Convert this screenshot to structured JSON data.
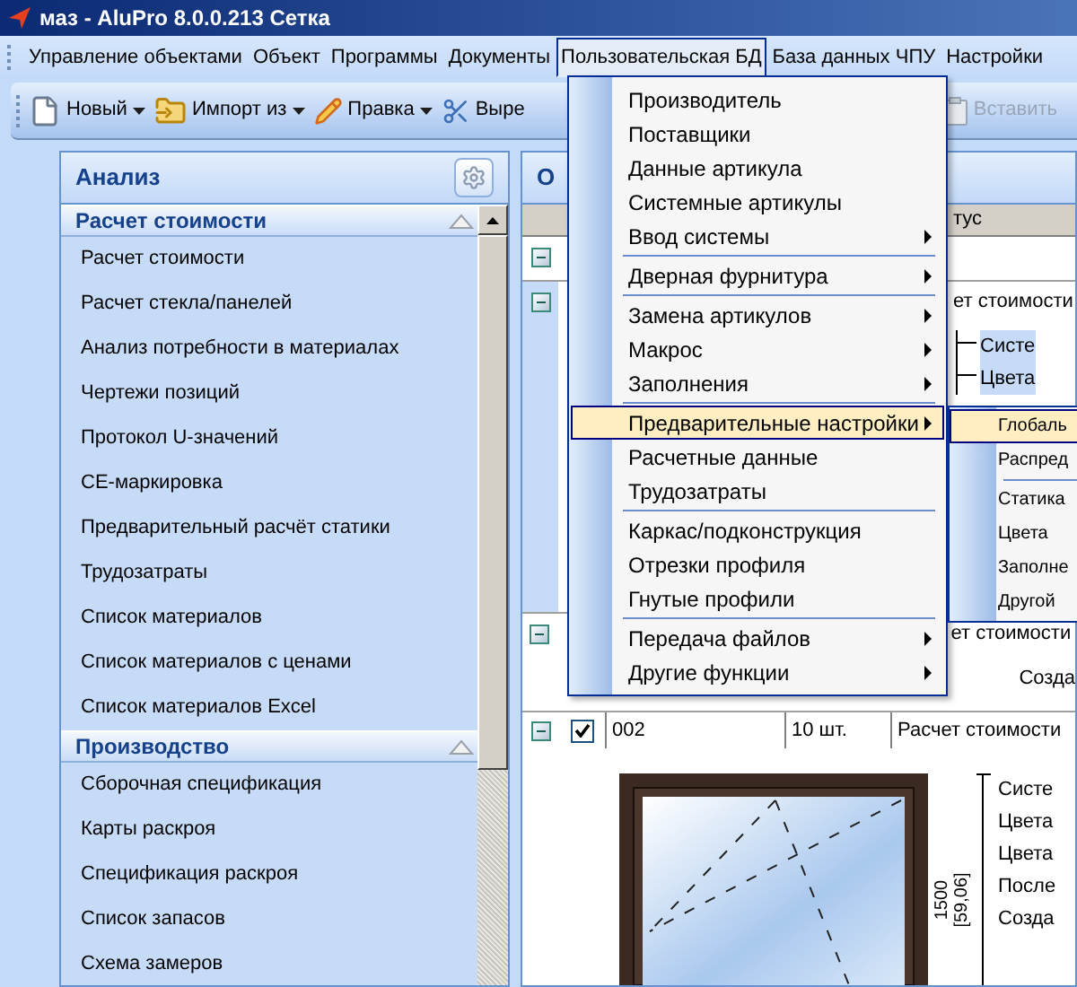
{
  "window": {
    "title": "маз - AluPro 8.0.0.213 Сетка"
  },
  "menubar": [
    {
      "label": "Управление объектами",
      "selected": false
    },
    {
      "label": "Объект",
      "selected": false
    },
    {
      "label": "Программы",
      "selected": false
    },
    {
      "label": "Документы",
      "selected": false
    },
    {
      "label": "Пользовательская БД",
      "selected": true
    },
    {
      "label": "База данных ЧПУ",
      "selected": false
    },
    {
      "label": "Настройки",
      "selected": false
    }
  ],
  "toolbar": [
    {
      "label": "Новый",
      "dropdown": true,
      "disabled": false
    },
    {
      "label": "Импорт из",
      "dropdown": true,
      "disabled": false
    },
    {
      "label": "Правка",
      "dropdown": true,
      "disabled": false
    },
    {
      "label": "Выре",
      "dropdown": false,
      "disabled": false
    },
    {
      "label": "Вставить",
      "dropdown": false,
      "disabled": true
    }
  ],
  "sidebar": {
    "title": "Анализ",
    "sections": [
      {
        "title": "Расчет стоимости",
        "expanded": true,
        "items": [
          "Расчет стоимости",
          "Расчет стекла/панелей",
          "Анализ потребности в материалах",
          "Чертежи позиций",
          "Протокол U-значений",
          "CE-маркировка",
          "Предварительный расчёт статики",
          "Трудозатраты",
          "Список материалов",
          "Список материалов с ценами",
          "Список материалов Excel"
        ]
      },
      {
        "title": "Производство",
        "expanded": true,
        "items": [
          "Сборочная спецификация",
          "Карты раскроя",
          "Спецификация раскроя",
          "Список запасов",
          "Схема замеров"
        ]
      }
    ]
  },
  "document_panel": {
    "title": "О",
    "column_header": "тус",
    "rows": [
      {
        "kind": "record",
        "expanded": true,
        "selected": false,
        "text": "",
        "details": []
      },
      {
        "kind": "record",
        "expanded": true,
        "selected": true,
        "text": "ет стоимости",
        "details": [
          "Систе",
          "Цвета"
        ]
      },
      {
        "kind": "record",
        "expanded": true,
        "selected": false,
        "text": "ет стоимости",
        "details": [
          "Созда"
        ]
      },
      {
        "kind": "position",
        "expanded": true,
        "checked": true,
        "cells": [
          "002",
          "10 шт.",
          "Расчет стоимости"
        ],
        "dimension": "1500",
        "dimension_inches": "[59,06]",
        "details": [
          "Систе",
          "Цвета",
          "Цвета",
          "После",
          "Созда"
        ]
      }
    ]
  },
  "context_menu": {
    "groups": [
      [
        {
          "label": "Производитель",
          "submenu": false,
          "selected": false
        },
        {
          "label": "Поставщики",
          "submenu": false,
          "selected": false
        },
        {
          "label": "Данные артикула",
          "submenu": false,
          "selected": false
        },
        {
          "label": "Системные артикулы",
          "submenu": false,
          "selected": false
        },
        {
          "label": "Ввод системы",
          "submenu": true,
          "selected": false
        }
      ],
      [
        {
          "label": "Дверная фурнитура",
          "submenu": true,
          "selected": false
        }
      ],
      [
        {
          "label": "Замена артикулов",
          "submenu": true,
          "selected": false
        },
        {
          "label": "Макрос",
          "submenu": true,
          "selected": false
        },
        {
          "label": "Заполнения",
          "submenu": true,
          "selected": false
        }
      ],
      [
        {
          "label": "Предварительные настройки",
          "submenu": true,
          "selected": true
        },
        {
          "label": "Расчетные данные",
          "submenu": false,
          "selected": false
        },
        {
          "label": "Трудозатраты",
          "submenu": false,
          "selected": false
        }
      ],
      [
        {
          "label": "Каркас/подконструкция",
          "submenu": false,
          "selected": false
        },
        {
          "label": "Отрезки профиля",
          "submenu": false,
          "selected": false
        },
        {
          "label": "Гнутые профили",
          "submenu": false,
          "selected": false
        }
      ],
      [
        {
          "label": "Передача файлов",
          "submenu": true,
          "selected": false
        },
        {
          "label": "Другие функции",
          "submenu": true,
          "selected": false
        }
      ]
    ]
  },
  "submenu": {
    "groups": [
      [
        {
          "label": "Глобаль",
          "selected": true
        },
        {
          "label": "Распред",
          "selected": false
        }
      ],
      [
        {
          "label": "Статика",
          "selected": false
        },
        {
          "label": "Цвета",
          "selected": false
        },
        {
          "label": "Заполне",
          "selected": false
        },
        {
          "label": "Другой",
          "selected": false
        }
      ]
    ]
  }
}
